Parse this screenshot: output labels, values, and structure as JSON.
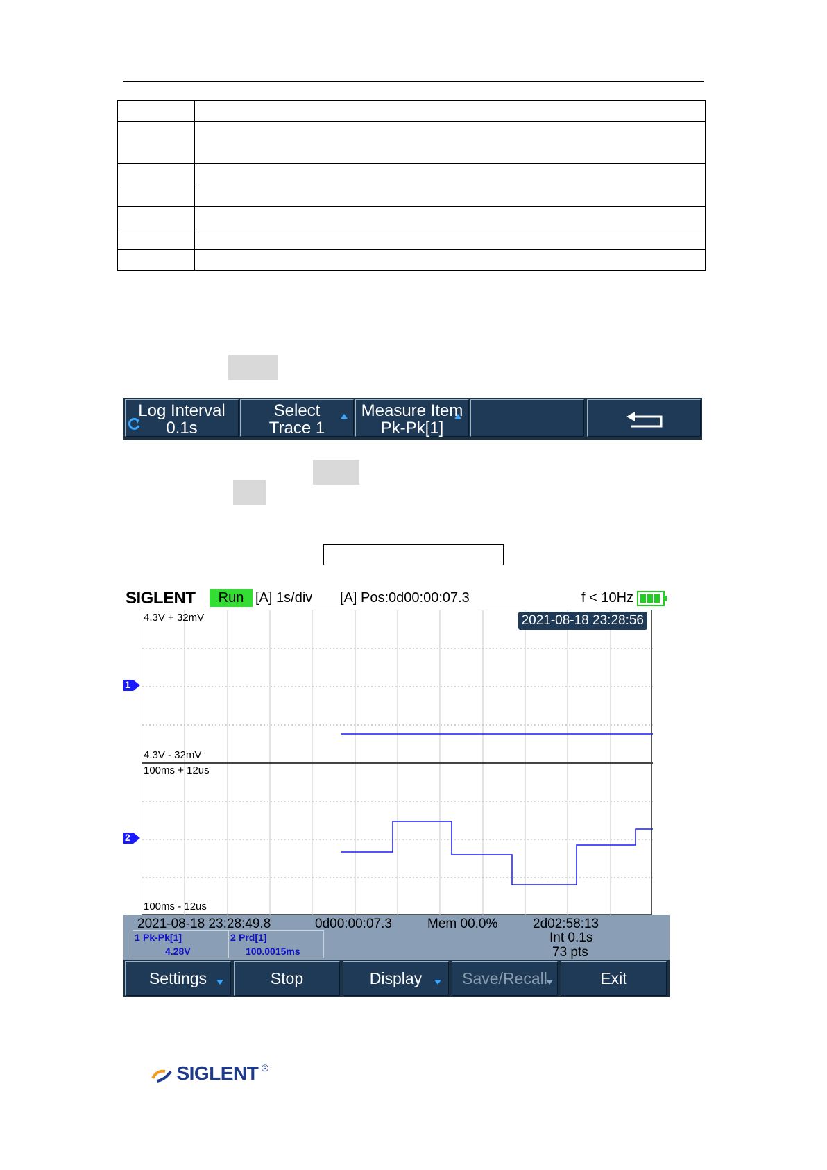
{
  "softkeys_top": [
    {
      "line1": "Log Interval",
      "line2": "0.1s"
    },
    {
      "line1": "Select",
      "line2": "Trace 1"
    },
    {
      "line1": "Measure Item",
      "line2": "Pk-Pk[1]"
    },
    {
      "line1": "",
      "line2": ""
    }
  ],
  "scope": {
    "brand": "SIGLENT",
    "status": "Run",
    "timebase": "[A] 1s/div",
    "position": "[A] Pos:0d00:00:07.3",
    "frequency": "f < 10Hz",
    "timestamp": "2021-08-18 23:28:56",
    "trace1": {
      "marker": "1",
      "top_label": "4.3V + 32mV",
      "bottom_label": "4.3V - 32mV"
    },
    "trace2": {
      "marker": "2",
      "top_label": "100ms + 12us",
      "bottom_label": "100ms - 12us"
    },
    "info": {
      "start_time": "2021-08-18 23:28:49.8",
      "elapsed": "0d00:00:07.3",
      "memory": "Mem 00.0%",
      "remaining": "2d02:58:13",
      "interval": "Int 0.1s",
      "points": "73 pts"
    },
    "measurements": [
      {
        "index": "1",
        "name": "Pk-Pk[1]",
        "value": "4.28V"
      },
      {
        "index": "2",
        "name": "Prd[1]",
        "value": "100.0015ms"
      }
    ],
    "bottom_keys": [
      {
        "label": "Settings"
      },
      {
        "label": "Stop"
      },
      {
        "label": "Display"
      },
      {
        "label": "Save/Recall"
      },
      {
        "label": "Exit"
      }
    ],
    "colors": {
      "trace": "#1a1aff",
      "run": "#33dd33",
      "bar": "#1e3a56",
      "info_bg": "#8a9fb5"
    }
  },
  "footer": {
    "logo": "SIGLENT",
    "registered": "®"
  }
}
